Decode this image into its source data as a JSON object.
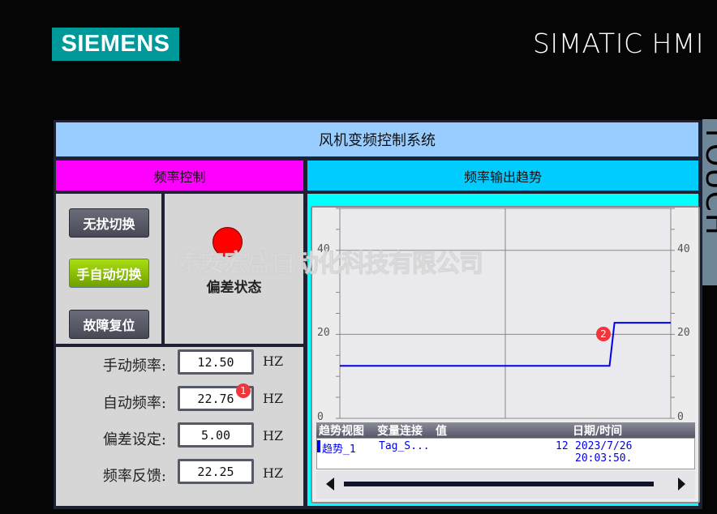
{
  "brand": {
    "logo": "SIEMENS",
    "product": "SIMATIC HMI",
    "side_label": "TOUCH"
  },
  "title": "风机变频控制系统",
  "left_header": "频率控制",
  "right_header": "频率输出趋势",
  "buttons": [
    {
      "label": "无扰切换"
    },
    {
      "label": "手自动切换"
    },
    {
      "label": "故障复位"
    }
  ],
  "status": {
    "label": "偏差状态",
    "color": "#ff0000"
  },
  "watermark": "泰安宏盛自动化科技有限公司",
  "fields": [
    {
      "label": "手动频率:",
      "value": "12.50",
      "unit": "HZ"
    },
    {
      "label": "自动频率:",
      "value": "22.76",
      "unit": "HZ"
    },
    {
      "label": "偏差设定:",
      "value": "5.00",
      "unit": "HZ"
    },
    {
      "label": "频率反馈:",
      "value": "22.25",
      "unit": "HZ"
    }
  ],
  "badges": [
    "1",
    "2"
  ],
  "trend": {
    "ylim": [
      0,
      50
    ],
    "yticks": [
      "0",
      "20",
      "40"
    ],
    "series": [
      {
        "name": "趋势_1",
        "color": "#0000ee",
        "points": [
          [
            0,
            12.5
          ],
          [
            0.815,
            12.5
          ],
          [
            0.83,
            22.76
          ],
          [
            1,
            22.76
          ]
        ]
      }
    ],
    "table": {
      "headers": [
        "趋势视图",
        "变量连接",
        "值",
        "日期/时间"
      ],
      "rows": [
        {
          "trend": "趋势_1",
          "tag": "Tag_S...",
          "value": "12",
          "datetime": "2023/7/26 20:03:50."
        }
      ]
    }
  }
}
